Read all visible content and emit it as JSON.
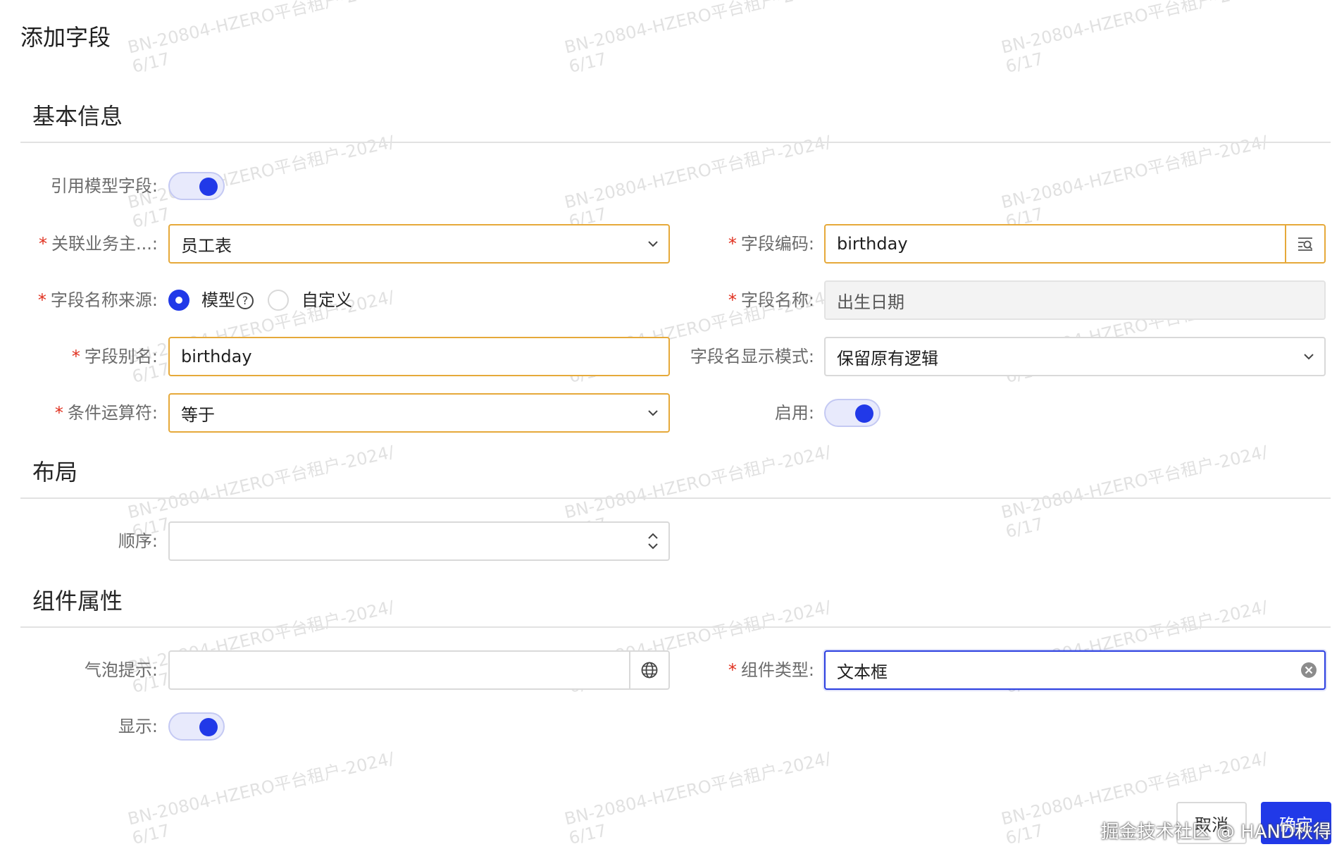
{
  "dialog": {
    "title": "添加字段"
  },
  "sections": {
    "basic": "基本信息",
    "layout": "布局",
    "component": "组件属性"
  },
  "fields": {
    "ref_model_field": {
      "label": "引用模型字段",
      "enabled": true
    },
    "business_object": {
      "label": "关联业务主...",
      "value": "员工表"
    },
    "field_code": {
      "label": "字段编码",
      "value": "birthday"
    },
    "name_source": {
      "label": "字段名称来源",
      "options": [
        "模型",
        "自定义"
      ],
      "selected": "模型"
    },
    "field_name": {
      "label": "字段名称",
      "value": "出生日期"
    },
    "field_alias": {
      "label": "字段别名",
      "value": "birthday"
    },
    "name_display_mode": {
      "label": "字段名显示模式",
      "value": "保留原有逻辑"
    },
    "operator": {
      "label": "条件运算符",
      "value": "等于"
    },
    "enabled": {
      "label": "启用",
      "enabled": true
    },
    "order": {
      "label": "顺序",
      "value": ""
    },
    "tooltip": {
      "label": "气泡提示",
      "value": ""
    },
    "component_type": {
      "label": "组件类型",
      "value": "文本框"
    },
    "visible": {
      "label": "显示",
      "enabled": true
    }
  },
  "colon": ":",
  "buttons": {
    "cancel": "取消",
    "ok": "确定"
  },
  "watermark": {
    "line1": "BN-20804-HZERO平台租户-2024/",
    "line2": "6/17"
  },
  "credit": "掘金技术社区 @ HAND秋得",
  "colors": {
    "primary": "#2139e8",
    "required": "#e0301e",
    "warning_border": "#e6a93a"
  }
}
